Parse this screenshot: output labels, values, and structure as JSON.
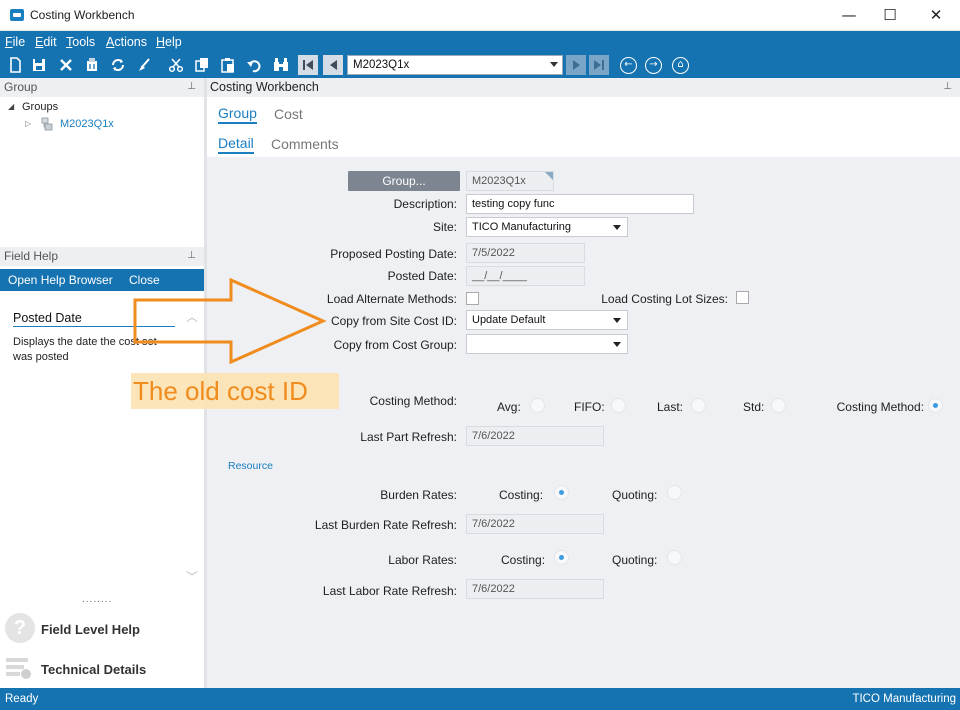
{
  "window": {
    "title": "Costing Workbench",
    "minimize_glyph": "—",
    "maximize_glyph": "☐",
    "close_glyph": "✕"
  },
  "menu": {
    "file": {
      "key": "F",
      "rest": "ile"
    },
    "edit": {
      "key": "E",
      "rest": "dit"
    },
    "tools": {
      "key": "T",
      "rest": "ools"
    },
    "actions": {
      "key": "A",
      "rest": "ctions"
    },
    "help": {
      "key": "H",
      "rest": "elp"
    }
  },
  "toolbar": {
    "icons": [
      "new-icon",
      "save-icon",
      "delete-icon",
      "clear-icon",
      "refresh-icon",
      "brush-icon",
      "cut-icon",
      "copy-icon",
      "paste-icon",
      "undo-icon",
      "binoculars-icon"
    ],
    "key_value": "M2023Q1x",
    "back_glyph": "←",
    "forward_glyph": "→",
    "home_glyph": "⌂"
  },
  "group_panel": {
    "header": "Group",
    "pin_glyph": "⊥",
    "tree": {
      "root_arrow": "◢",
      "root_label": "Groups",
      "child_arrow": "▷",
      "child_label": "M2023Q1x"
    }
  },
  "field_help": {
    "header": "Field Help",
    "open_label": "Open Help Browser",
    "close_label": "Close",
    "topic_title": "Posted Date",
    "topic_body": "Displays the date the cost set was posted",
    "scroll_up": "︿",
    "scroll_down": "﹀",
    "grip": "........",
    "field_level_help": "Field Level Help",
    "technical_details": "Technical Details",
    "question_glyph": "?"
  },
  "main": {
    "header": "Costing Workbench",
    "tabs_top": [
      {
        "label": "Group"
      },
      {
        "label": "Cost"
      }
    ],
    "tabs_sub": [
      {
        "label": "Detail"
      },
      {
        "label": "Comments"
      }
    ]
  },
  "form": {
    "group_button": "Group...",
    "group_id": "M2023Q1x",
    "description_label": "Description:",
    "description_value": "testing copy func",
    "site_label": "Site:",
    "site_value": "TICO Manufacturing",
    "proposed_posting_date_label": "Proposed Posting Date:",
    "proposed_posting_date_value": "7/5/2022",
    "posted_date_label": "Posted Date:",
    "posted_date_value": "__/__/____",
    "load_alternate_methods_label": "Load Alternate Methods:",
    "load_costing_lot_sizes_label": "Load Costing Lot Sizes:",
    "copy_from_site_cost_id_label": "Copy from Site Cost ID:",
    "copy_from_site_cost_id_value": "Update Default",
    "copy_from_cost_group_label": "Copy from Cost Group:",
    "copy_from_cost_group_value": "",
    "costing_method_label": "Costing Method:",
    "method_options": [
      {
        "label": "Avg:",
        "selected": false
      },
      {
        "label": "FIFO:",
        "selected": false
      },
      {
        "label": "Last:",
        "selected": false
      },
      {
        "label": "Std:",
        "selected": false
      },
      {
        "label": "Costing Method:",
        "selected": true
      }
    ],
    "last_part_refresh_label": "Last Part Refresh:",
    "last_part_refresh_value": "7/6/2022",
    "resource_label": "Resource",
    "burden_rates_label": "Burden Rates:",
    "burden_costing_label": "Costing:",
    "burden_quoting_label": "Quoting:",
    "burden_selected": "Costing",
    "last_burden_rate_refresh_label": "Last Burden Rate Refresh:",
    "last_burden_rate_refresh_value": "7/6/2022",
    "labor_rates_label": "Labor Rates:",
    "labor_costing_label": "Costing:",
    "labor_quoting_label": "Quoting:",
    "labor_selected": "Costing",
    "last_labor_rate_refresh_label": "Last Labor Rate Refresh:",
    "last_labor_rate_refresh_value": "7/6/2022"
  },
  "annotation": {
    "text": "The old cost ID",
    "color": "#f08c1e"
  },
  "status": {
    "left": "Ready",
    "right": "TICO Manufacturing"
  },
  "colors": {
    "accent": "#1673b1",
    "link": "#1a7fc1",
    "form_bg": "#eef0f3"
  }
}
